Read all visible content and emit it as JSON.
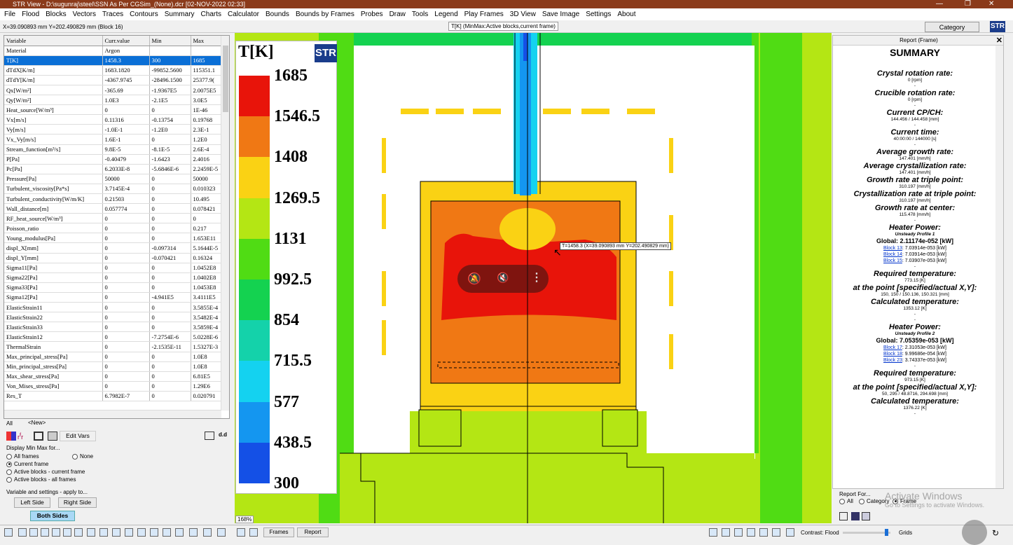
{
  "app": {
    "title": "STR View - D:\\sugunraj\\steel\\SSN As Per CGSim_(None).dcr [02-NOV-2022  02:33]"
  },
  "menu": [
    "File",
    "Flood",
    "Blocks",
    "Vectors",
    "Traces",
    "Contours",
    "Summary",
    "Charts",
    "Calculator",
    "Bounds",
    "Bounds by Frames",
    "Probes",
    "Draw",
    "Tools",
    "Legend",
    "Play Frames",
    "3D View",
    "Save Image",
    "Settings",
    "About"
  ],
  "coordbar": {
    "coords": "X=39.090893 mm Y=202.490829 mm (Block 16)",
    "minmax": "T[K]  (MinMax:Active blocks,current frame)",
    "category_button": "Category",
    "logo": "STR"
  },
  "table": {
    "headers": [
      "Variable",
      "Curr.value",
      "Min",
      "Max"
    ],
    "rows": [
      [
        "Material",
        "Argon",
        "",
        ""
      ],
      [
        "T[K]",
        "1458.3",
        "300",
        "1685"
      ],
      [
        "dTdX[K/m]",
        "1683.1820",
        "-99852.5600",
        "115351.1"
      ],
      [
        "dTdY[K/m]",
        "-4367.9745",
        "-28496.1500",
        "25377.9("
      ],
      [
        "Qx[W/m²]",
        "-365.69",
        "-1.9367E5",
        "2.0075E5"
      ],
      [
        "Qy[W/m²]",
        "1.0E3",
        "-2.1E5",
        "3.0E5"
      ],
      [
        "Heat_source[W/m³]",
        "0",
        "0",
        "1E-46"
      ],
      [
        "Vx[m/s]",
        "0.11316",
        "-0.13754",
        "0.19768"
      ],
      [
        "Vy[m/s]",
        "-1.0E-1",
        "-1.2E0",
        "2.3E-1"
      ],
      [
        "Vx_Vy[m/s]",
        "1.6E-1",
        "0",
        "1.2E0"
      ],
      [
        "Stream_function[m³/s]",
        "9.8E-5",
        "-8.1E-5",
        "2.6E-4"
      ],
      [
        "P[Pa]",
        "-0.40479",
        "-1.6423",
        "2.4016"
      ],
      [
        "Pc[Pa]",
        "6.2033E-8",
        "-5.6846E-6",
        "2.2459E-5"
      ],
      [
        "Pressure[Pa]",
        "50000",
        "0",
        "50000"
      ],
      [
        "Turbulent_viscosity[Pa*s]",
        "3.7145E-4",
        "0",
        "0.010323"
      ],
      [
        "Turbulent_conductivity[W/m/K]",
        "0.21503",
        "0",
        "10.495"
      ],
      [
        "Wall_distance[m]",
        "0.057774",
        "0",
        "0.078421"
      ],
      [
        "RF_heat_source[W/m³]",
        "0",
        "0",
        "0"
      ],
      [
        "Poisson_ratio",
        "0",
        "0",
        "0.217"
      ],
      [
        "Young_modulus[Pa]",
        "0",
        "0",
        "1.653E11"
      ],
      [
        "displ_X[mm]",
        "0",
        "-0.097314",
        "5.1644E-5"
      ],
      [
        "displ_Y[mm]",
        "0",
        "-0.070421",
        "0.16324"
      ],
      [
        "Sigma11[Pa]",
        "0",
        "0",
        "1.0452E8"
      ],
      [
        "Sigma22[Pa]",
        "0",
        "0",
        "1.0402E8"
      ],
      [
        "Sigma33[Pa]",
        "0",
        "0",
        "1.0453E8"
      ],
      [
        "Sigma12[Pa]",
        "0",
        "-4.941E5",
        "3.4111E5"
      ],
      [
        "ElasticStrain11",
        "0",
        "0",
        "3.5855E-4"
      ],
      [
        "ElasticStrain22",
        "0",
        "0",
        "3.5482E-4"
      ],
      [
        "ElasticStrain33",
        "0",
        "0",
        "3.5859E-4"
      ],
      [
        "ElasticStrain12",
        "0",
        "-7.2754E-6",
        "5.0228E-6"
      ],
      [
        "ThermalStrain",
        "0",
        "-2.1535E-11",
        "1.5327E-3"
      ],
      [
        "Max_principal_stress[Pa]",
        "0",
        "0",
        "1.0E8"
      ],
      [
        "Min_principal_stress[Pa]",
        "0",
        "0",
        "1.0E8"
      ],
      [
        "Max_shear_stress[Pa]",
        "0",
        "0",
        "6.81E5"
      ],
      [
        "Von_Mises_stress[Pa]",
        "0",
        "0",
        "1.29E6"
      ],
      [
        "Res_T",
        "6.7982E-7",
        "0",
        "0.020791"
      ]
    ]
  },
  "tabs": {
    "all": "All",
    "new": "<New>"
  },
  "toolbar_left": {
    "edit_vars": "Edit Vars"
  },
  "display_minmax": {
    "label": "Display Min Max for...",
    "options": [
      "All frames",
      "Current frame",
      "Active blocks - current frame",
      "Active blocks - all frames"
    ],
    "none_option": "None",
    "selected": "Current frame"
  },
  "apply": {
    "label": "Variable and settings - apply to...",
    "left": "Left Side",
    "right": "Right Side",
    "both": "Both Sides"
  },
  "legend": {
    "title": "T[K]",
    "logo": "STR",
    "values": [
      "1685",
      "1546.5",
      "1408",
      "1269.5",
      "1131",
      "992.5",
      "854",
      "715.5",
      "577",
      "438.5",
      "300"
    ],
    "colors": [
      "#e8140a",
      "#f07814",
      "#fad214",
      "#b4e614",
      "#50dc14",
      "#14d250",
      "#14d2aa",
      "#14d2f0",
      "#1496f0",
      "#1450e6",
      "#1414d2"
    ]
  },
  "zoom": "168%",
  "tooltip": "T=1458.3 (X=39.090893 mm Y=202.490829 mm)",
  "report": {
    "header": "Report (Frame)",
    "title": "SUMMARY",
    "crystal_rot": {
      "h": "Crystal rotation rate:",
      "v": "0 [rpm]"
    },
    "crucible_rot": {
      "h": "Crucible rotation rate:",
      "v": "0 [rpm]"
    },
    "cpch": {
      "h": "Current CP/CH:",
      "v": "144.456 / 144.458 [mm]"
    },
    "time": {
      "h": "Current time:",
      "v": "40:00:00 / 144000 [s]"
    },
    "avg_growth": {
      "h": "Average growth rate:",
      "v": "147.401 [mm/h]"
    },
    "avg_cryst": {
      "h": "Average crystallization rate:",
      "v": "147.401 [mm/h]"
    },
    "growth_triple": {
      "h": "Growth rate at triple point:",
      "v": "310.197 [mm/h]"
    },
    "cryst_triple": {
      "h": "Crystallization rate at triple point:",
      "v": "310.197 [mm/h]"
    },
    "growth_center": {
      "h": "Growth rate at center:",
      "v": "115.478 [mm/h]"
    },
    "heater1": {
      "h": "Heater Power:",
      "profile": "Unsteady Profile 1",
      "global": "Global: 2.11174e-052 [kW]",
      "blocks": [
        {
          "link": "Block 13",
          "val": ": 7.03914e-053 [kW]"
        },
        {
          "link": "Block 14",
          "val": ": 7.03914e-053 [kW]"
        },
        {
          "link": "Block 15",
          "val": ": 7.03907e-053 [kW]"
        }
      ],
      "req_h": "Required temperature:",
      "req_v": "773.15 [K]",
      "pt_h": "at the point [specified/actual X,Y]:",
      "pt_v": "150, 150 / 150.136, 150.321 [mm]",
      "calc_h": "Calculated temperature:",
      "calc_v": "1353.12 [K]"
    },
    "heater2": {
      "h": "Heater Power:",
      "profile": "Unsteady Profile 2",
      "global": "Global: 7.05359e-053 [kW]",
      "blocks": [
        {
          "link": "Block 17",
          "val": ": 2.31053e-053 [kW]"
        },
        {
          "link": "Block 18",
          "val": ": 9.99686e-054 [kW]"
        },
        {
          "link": "Block 23",
          "val": ": 3.74337e-053 [kW]"
        }
      ],
      "req_h": "Required temperature:",
      "req_v": "973.15 [K]",
      "pt_h": "at the point [specified/actual X,Y]:",
      "pt_v": "50, 295 / 48.8716, 294.698 [mm]",
      "calc_h": "Calculated temperature:",
      "calc_v": "1376.22 [K]"
    },
    "report_for": "Report For...",
    "rf_options": [
      "All",
      "Category",
      "Frame"
    ]
  },
  "watermark": {
    "line1": "Activate Windows",
    "line2": "Go to Settings to activate Windows."
  },
  "statusbar": {
    "frames": "Frames",
    "report": "Report",
    "contrast": "Contrast: Flood",
    "grids": "Grids"
  }
}
